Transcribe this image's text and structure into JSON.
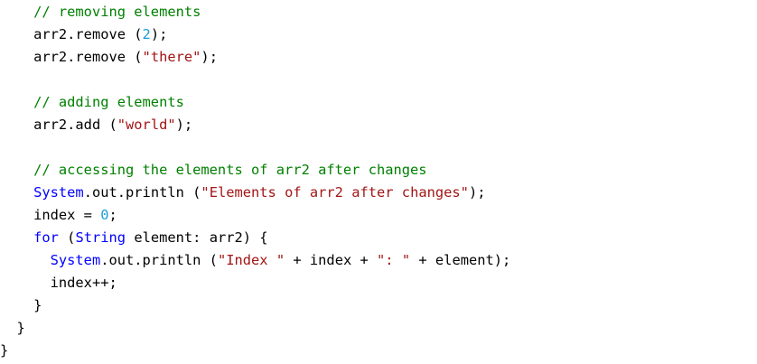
{
  "editor": {
    "lines": [
      {
        "indent": "    ",
        "tokens": [
          {
            "t": "// removing elements",
            "k": "comment"
          }
        ]
      },
      {
        "indent": "    ",
        "tokens": [
          {
            "t": "arr2.remove (",
            "k": "default"
          },
          {
            "t": "2",
            "k": "number"
          },
          {
            "t": ");",
            "k": "default"
          }
        ]
      },
      {
        "indent": "    ",
        "tokens": [
          {
            "t": "arr2.remove (",
            "k": "default"
          },
          {
            "t": "\"there\"",
            "k": "string"
          },
          {
            "t": ");",
            "k": "default"
          }
        ]
      },
      {
        "indent": "",
        "tokens": []
      },
      {
        "indent": "    ",
        "tokens": [
          {
            "t": "// adding elements",
            "k": "comment"
          }
        ]
      },
      {
        "indent": "    ",
        "tokens": [
          {
            "t": "arr2.add (",
            "k": "default"
          },
          {
            "t": "\"world\"",
            "k": "string"
          },
          {
            "t": ");",
            "k": "default"
          }
        ]
      },
      {
        "indent": "",
        "tokens": []
      },
      {
        "indent": "    ",
        "tokens": [
          {
            "t": "// accessing the elements of arr2 after changes",
            "k": "comment"
          }
        ]
      },
      {
        "indent": "    ",
        "tokens": [
          {
            "t": "System",
            "k": "class"
          },
          {
            "t": ".out.println (",
            "k": "default"
          },
          {
            "t": "\"Elements of arr2 after changes\"",
            "k": "string"
          },
          {
            "t": ");",
            "k": "default"
          }
        ]
      },
      {
        "indent": "    ",
        "tokens": [
          {
            "t": "index = ",
            "k": "default"
          },
          {
            "t": "0",
            "k": "number"
          },
          {
            "t": ";",
            "k": "default"
          }
        ]
      },
      {
        "indent": "    ",
        "tokens": [
          {
            "t": "for",
            "k": "keyword"
          },
          {
            "t": " (",
            "k": "default"
          },
          {
            "t": "String",
            "k": "class"
          },
          {
            "t": " element: arr2) {",
            "k": "default"
          }
        ]
      },
      {
        "indent": "      ",
        "tokens": [
          {
            "t": "System",
            "k": "class"
          },
          {
            "t": ".out.println (",
            "k": "default"
          },
          {
            "t": "\"Index \"",
            "k": "string"
          },
          {
            "t": " + index + ",
            "k": "default"
          },
          {
            "t": "\": \"",
            "k": "string"
          },
          {
            "t": " + element);",
            "k": "default"
          }
        ]
      },
      {
        "indent": "      ",
        "tokens": [
          {
            "t": "index++;",
            "k": "default"
          }
        ]
      },
      {
        "indent": "    ",
        "tokens": [
          {
            "t": "}",
            "k": "default"
          }
        ]
      },
      {
        "indent": "  ",
        "tokens": [
          {
            "t": "}",
            "k": "default"
          }
        ]
      },
      {
        "indent": "",
        "tokens": [
          {
            "t": "}",
            "k": "default"
          }
        ]
      }
    ]
  }
}
